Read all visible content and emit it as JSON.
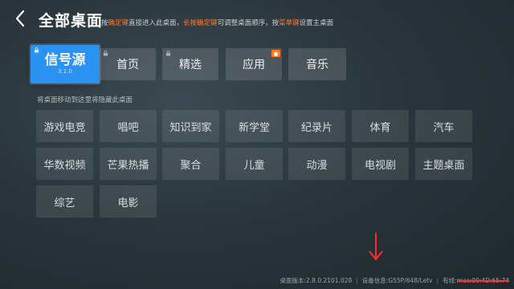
{
  "header": {
    "title": "全部桌面",
    "hint": {
      "p1": "按",
      "k1": "确定键",
      "p2": "直接进入此桌面，",
      "k2": "长按确定键",
      "p3": "可调整桌面顺序，按",
      "k3": "菜单键",
      "p4": "设置主桌面"
    }
  },
  "active_desktops": [
    {
      "label": "信号源",
      "version": "3.1.0",
      "locked": true,
      "focused": true
    },
    {
      "label": "首页",
      "locked": true
    },
    {
      "label": "精选",
      "locked": true
    },
    {
      "label": "应用",
      "home": true
    },
    {
      "label": "音乐"
    }
  ],
  "hidden_section_label": "将桌面移动到这里将隐藏此桌面",
  "hidden_desktops": [
    "游戏电竞",
    "唱吧",
    "知识到家",
    "新学堂",
    "纪录片",
    "体育",
    "汽车",
    "华数视频",
    "芒果热播",
    "聚合",
    "儿童",
    "动漫",
    "电视剧",
    "主题桌面",
    "综艺",
    "电影"
  ],
  "footer": {
    "version": "桌面版本:2.8.0.2101.028",
    "device": "设备信息:G55P/648/Letv",
    "network": "有线:",
    "network_value": "mac:00:4D:65:74"
  },
  "colors": {
    "focus": "#2a93f2",
    "highlight": "#ff7a2b",
    "annotation_red": "#ff2b2b"
  }
}
